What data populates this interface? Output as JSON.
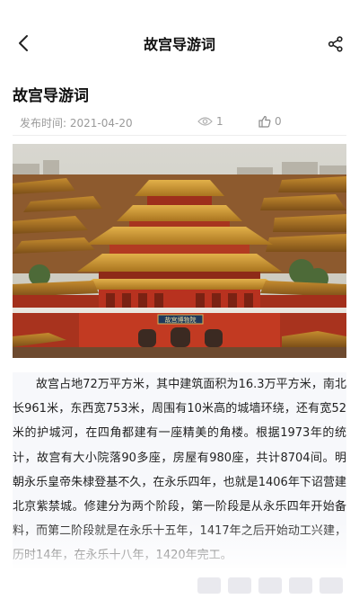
{
  "header": {
    "title": "故宫导游词",
    "back_icon": "chevron-left-icon",
    "share_icon": "share-icon"
  },
  "article": {
    "title": "故宫导游词",
    "published_label": "发布时间:",
    "published_date": "2021-04-20",
    "views": "1",
    "likes": "0",
    "image_sign_text": "故宫博物院",
    "body": "故宫占地72万平方米，其中建筑面积为16.3万平方米，南北长961米，东西宽753米，周围有10米高的城墙环绕，还有宽52米的护城河，在四角都建有一座精美的角楼。根据1973年的统计，故宫有大小院落90多座，房屋有980座，共计8704间。明朝永乐皇帝朱棣登基不久，在永乐四年，也就是1406年下诏营建北京紫禁城。修建分为两个阶段，第一阶段是从永乐四年开始备料，而第二阶段就是在永乐十五年，1417年之后开始动工兴建，历时14年，在永乐十八年，1420年完工。"
  },
  "colors": {
    "title": "#111111",
    "meta": "#9a9a9a",
    "roof_gold": "#d9a13a",
    "wall_red": "#b8321f",
    "sky": "#dcdcd6"
  }
}
